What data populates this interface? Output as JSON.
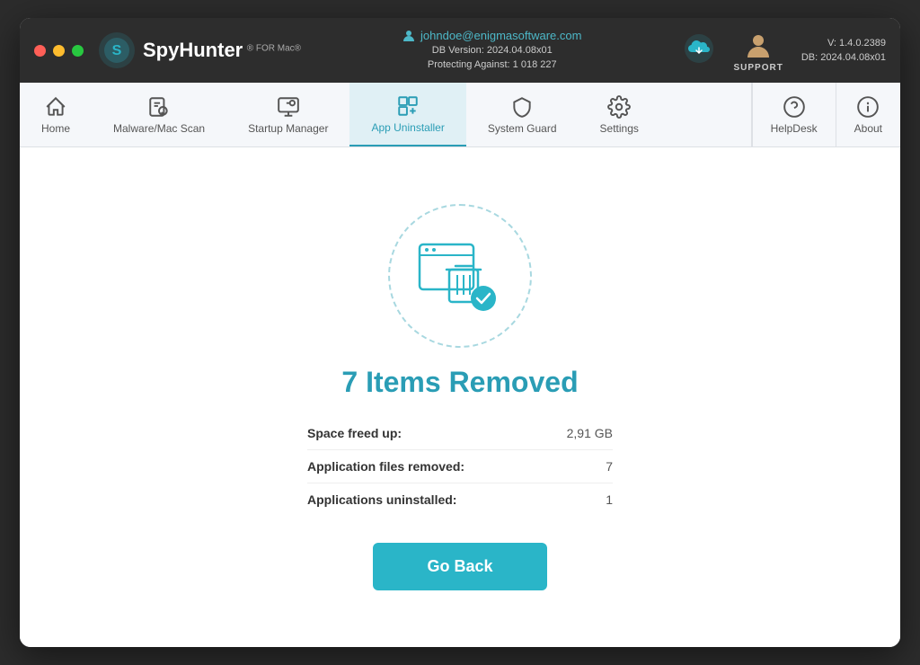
{
  "window": {
    "title": "SpyHunter for Mac"
  },
  "titlebar": {
    "email": "johndoe@enigmasoftware.com",
    "db_version_label": "DB Version: 2024.04.08x01",
    "protecting_label": "Protecting Against: 1 018 227",
    "support_label": "SUPPORT",
    "version": "V: 1.4.0.2389",
    "db_short": "DB:  2024.04.08x01"
  },
  "nav": {
    "items": [
      {
        "id": "home",
        "label": "Home"
      },
      {
        "id": "malware-scan",
        "label": "Malware/Mac Scan"
      },
      {
        "id": "startup-manager",
        "label": "Startup Manager"
      },
      {
        "id": "app-uninstaller",
        "label": "App Uninstaller"
      },
      {
        "id": "system-guard",
        "label": "System Guard"
      },
      {
        "id": "settings",
        "label": "Settings"
      }
    ],
    "right_items": [
      {
        "id": "helpdesk",
        "label": "HelpDesk"
      },
      {
        "id": "about",
        "label": "About"
      }
    ]
  },
  "main": {
    "result_title": "7 Items Removed",
    "stats": [
      {
        "label": "Space freed up:",
        "value": "2,91 GB"
      },
      {
        "label": "Application files removed:",
        "value": "7"
      },
      {
        "label": "Applications uninstalled:",
        "value": "1"
      }
    ],
    "go_back_label": "Go Back"
  }
}
